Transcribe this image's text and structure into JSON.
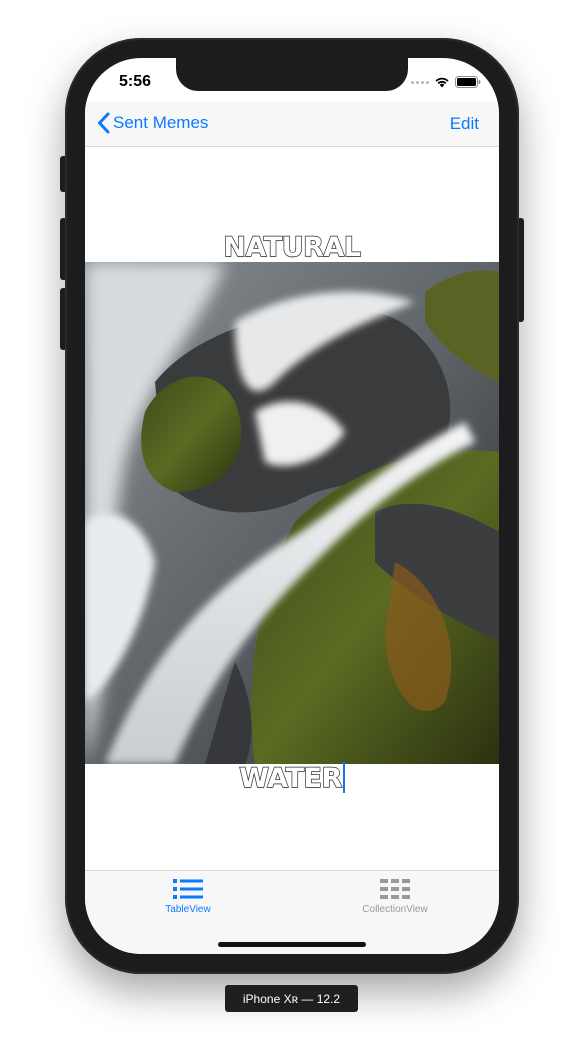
{
  "status_bar": {
    "time": "5:56"
  },
  "navbar": {
    "back_label": "Sent Memes",
    "edit_label": "Edit"
  },
  "meme": {
    "top_text": "NATURAL",
    "bottom_text": "WATER",
    "image_subject": "waterfall over mossy rocks"
  },
  "tabbar": {
    "tabs": [
      {
        "label": "TableView",
        "icon": "list-icon",
        "selected": true
      },
      {
        "label": "CollectionView",
        "icon": "grid-icon",
        "selected": false
      }
    ]
  },
  "device_label": "iPhone Xʀ — 12.2",
  "colors": {
    "accent": "#0a7aff",
    "inactive": "#999999",
    "frame": "#1c1c1e"
  }
}
